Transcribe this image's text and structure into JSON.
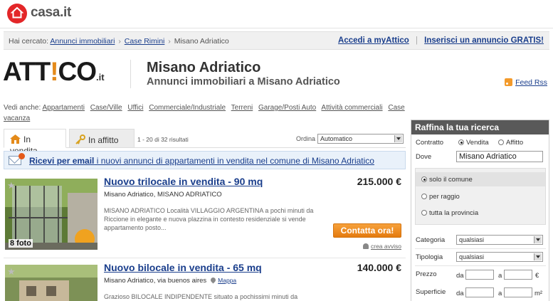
{
  "brand": {
    "name": "casa.it"
  },
  "breadcrumb": {
    "prefix": "Hai cercato:",
    "items": [
      "Annunci immobiliari",
      "Case Rimini",
      "Misano Adriatico"
    ],
    "sep": "›"
  },
  "top_links": {
    "accedi": "Accedi a myAttico",
    "inserisci": "Inserisci un annuncio GRATIS!",
    "sep": "|"
  },
  "attico": {
    "part1": "ATT",
    "bang": "!",
    "part2": "CO",
    "suffix": ".it"
  },
  "header": {
    "title": "Misano Adriatico",
    "subtitle": "Annunci immobiliari a Misano Adriatico",
    "feed": "Feed Rss"
  },
  "vedi_anche": {
    "label": "Vedi anche:",
    "items": [
      "Appartamenti",
      "Case/Ville",
      "Uffici",
      "Commerciale/Industriale",
      "Terreni",
      "Garage/Posti Auto",
      "Attività commerciali",
      "Case vacanza"
    ]
  },
  "tabs": {
    "vendita": "In vendita",
    "affitto": "In affitto"
  },
  "results": {
    "count": "1 - 20 di 32 risultati",
    "ordina_label": "Ordina",
    "ordina_value": "Automatico"
  },
  "email_banner": {
    "bold": "Ricevi per email",
    "rest": " i nuovi annunci di appartamenti in vendita nel comune di Misano Adriatico"
  },
  "listings": [
    {
      "title": "Nuovo trilocale in vendita - 90 mq",
      "price": "215.000 €",
      "location": "Misano Adriatico, MISANO ADRIATICO",
      "description": "MISANO ADRIATICO Località VILLAGGIO ARGENTINA a pochi minuti da Riccione in elegante e nuova plazzina in contesto residenziale si vende appartamento posto...",
      "photos": "8 foto",
      "cta": "Contatta ora!",
      "alert": "crea avviso"
    },
    {
      "title": "Nuovo bilocale in vendita - 65 mq",
      "price": "140.000 €",
      "location": "Misano Adriatico, via buenos aires",
      "map": "Mappa",
      "description": "Grazioso BILOCALE INDIPENDENTE situato a pochissimi minuti da"
    }
  ],
  "refine": {
    "title": "Raffina la tua ricerca",
    "contratto_label": "Contratto",
    "vendita": "Vendita",
    "affitto": "Affitto",
    "dove_label": "Dove",
    "dove_value": "Misano Adriatico",
    "scope": [
      "solo il comune",
      "per raggio",
      "tutta la provincia"
    ],
    "categoria_label": "Categoria",
    "categoria_value": "qualsiasi",
    "tipologia_label": "Tipologia",
    "tipologia_value": "qualsiasi",
    "prezzo_label": "Prezzo",
    "superficie_label": "Superficie",
    "da": "da",
    "a": "a",
    "euro": "€",
    "mq": "m²"
  }
}
